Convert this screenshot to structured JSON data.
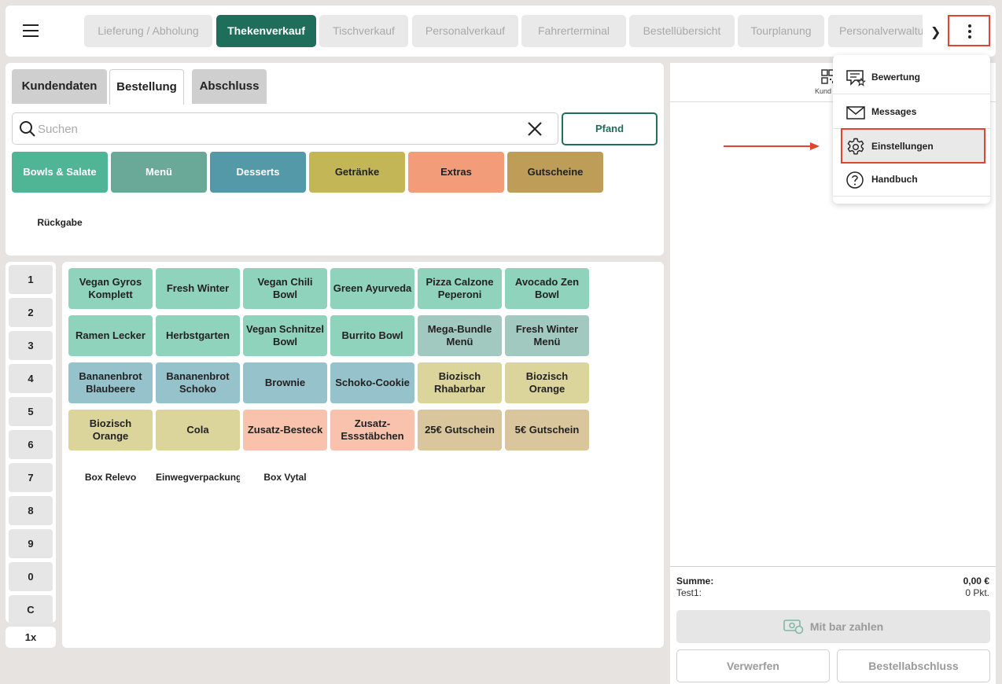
{
  "topbar": {
    "tabs": [
      {
        "label": "Lieferung / Abholung",
        "active": false
      },
      {
        "label": "Thekenverkauf",
        "active": true
      },
      {
        "label": "Tischverkauf",
        "active": false
      },
      {
        "label": "Personalverkauf",
        "active": false
      },
      {
        "label": "Fahrerterminal",
        "active": false
      },
      {
        "label": "Bestellübersicht",
        "active": false
      },
      {
        "label": "Tourplanung",
        "active": false
      },
      {
        "label": "Personalverwaltung",
        "active": false
      }
    ],
    "next_icon": "chevron-right-icon",
    "menu_icon": "kebab-menu-icon"
  },
  "left": {
    "tabs": [
      {
        "label": "Kundendaten",
        "active": false
      },
      {
        "label": "Bestellung",
        "active": true
      },
      {
        "label": "Abschluss",
        "active": false
      }
    ],
    "search_placeholder": "Suchen",
    "search_value": "",
    "pfand_label": "Pfand",
    "categories": [
      {
        "label": "Bowls & Salate",
        "color": "#4fb594"
      },
      {
        "label": "Menü",
        "color": "#6aa898"
      },
      {
        "label": "Desserts",
        "color": "#5499a8"
      },
      {
        "label": "Getränke",
        "color": "#c2b657",
        "text": "#222"
      },
      {
        "label": "Extras",
        "color": "#f39c79",
        "text": "#222"
      },
      {
        "label": "Gutscheine",
        "color": "#bd9d57",
        "text": "#222"
      }
    ],
    "rueckgabe_label": "Rückgabe"
  },
  "numpad": {
    "keys": [
      "1",
      "2",
      "3",
      "4",
      "5",
      "6",
      "7",
      "8",
      "9",
      "0",
      "C"
    ],
    "quantity": "1x"
  },
  "products": [
    {
      "label": "Vegan Gyros Komplett",
      "color": "#8fd3bc"
    },
    {
      "label": "Fresh Winter",
      "color": "#8fd3bc"
    },
    {
      "label": "Vegan Chili Bowl",
      "color": "#8fd3bc"
    },
    {
      "label": "Green Ayurveda",
      "color": "#8fd3bc"
    },
    {
      "label": "Pizza Calzone Peperoni",
      "color": "#8fd3bc"
    },
    {
      "label": "Avocado Zen Bowl",
      "color": "#8fd3bc"
    },
    {
      "label": "Ramen Lecker",
      "color": "#8fd3bc"
    },
    {
      "label": "Herbstgarten",
      "color": "#8fd3bc"
    },
    {
      "label": "Vegan Schnitzel Bowl",
      "color": "#8fd3bc"
    },
    {
      "label": "Burrito Bowl",
      "color": "#8fd3bc"
    },
    {
      "label": "Mega-Bundle Menü",
      "color": "#a2c9bf"
    },
    {
      "label": "Fresh Winter Menü",
      "color": "#a2c9bf"
    },
    {
      "label": "Bananenbrot Blaubeere",
      "color": "#96c2cb"
    },
    {
      "label": "Bananenbrot Schoko",
      "color": "#96c2cb"
    },
    {
      "label": "Brownie",
      "color": "#96c2cb"
    },
    {
      "label": "Schoko-Cookie",
      "color": "#96c2cb"
    },
    {
      "label": "Biozisch Rhabarbar",
      "color": "#dbd49b"
    },
    {
      "label": "Biozisch Orange",
      "color": "#dbd49b"
    },
    {
      "label": "Biozisch Orange",
      "color": "#dbd49b"
    },
    {
      "label": "Cola",
      "color": "#dbd49b"
    },
    {
      "label": "Zusatz-Besteck",
      "color": "#f8c2ac"
    },
    {
      "label": "Zusatz-Essstäbchen",
      "color": "#f8c2ac"
    },
    {
      "label": "25€ Gutschein",
      "color": "#d9c69c"
    },
    {
      "label": "5€ Gutschein",
      "color": "#d9c69c"
    }
  ],
  "plain_products": [
    "Box Relevo",
    "Einwegverpackung",
    "Box Vytal"
  ],
  "cart": {
    "header_label": "Kund",
    "summe_label": "Summe:",
    "summe_value": "0,00 €",
    "points_label": "Test1:",
    "points_value": "0 Pkt.",
    "pay_label": "Mit bar zahlen",
    "discard_label": "Verwerfen",
    "finish_label": "Bestellabschluss"
  },
  "dropdown": {
    "items": [
      {
        "label": "Bewertung",
        "icon": "rating-icon"
      },
      {
        "label": "Messages",
        "icon": "envelope-icon"
      },
      {
        "label": "Einstellungen",
        "icon": "gear-icon"
      },
      {
        "label": "Handbuch",
        "icon": "help-icon"
      }
    ],
    "highlighted": "Einstellungen"
  },
  "colors": {
    "accent": "#1f6e5b",
    "highlight": "#e0452d"
  }
}
